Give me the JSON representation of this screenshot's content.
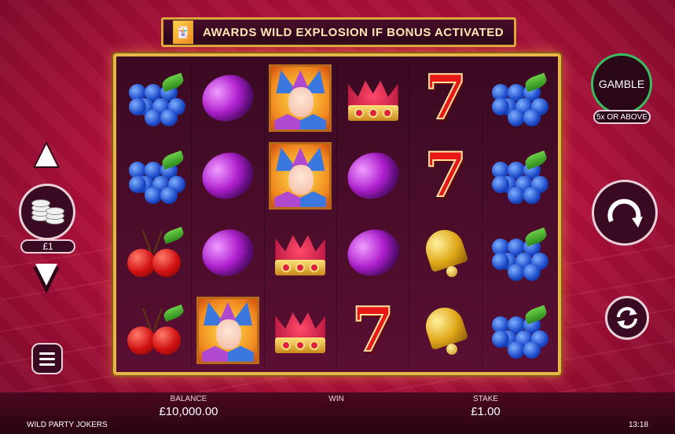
{
  "banner": {
    "text": "AWARDS WILD EXPLOSION IF BONUS ACTIVATED",
    "icon": "joker-icon"
  },
  "reels": [
    [
      "blueberry",
      "plum",
      "joker",
      "crown",
      "seven",
      "blueberry"
    ],
    [
      "blueberry",
      "plum",
      "joker",
      "plum",
      "seven",
      "blueberry"
    ],
    [
      "cherry",
      "plum",
      "crown",
      "plum",
      "bell",
      "blueberry"
    ],
    [
      "cherry",
      "joker",
      "crown",
      "seven",
      "bell",
      "blueberry"
    ]
  ],
  "controls": {
    "gamble_label": "GAMBLE",
    "gamble_sub": "5x OR ABOVE",
    "stake_pill": "£1"
  },
  "bottom": {
    "balance_label": "BALANCE",
    "balance_value": "£10,000.00",
    "win_label": "WIN",
    "win_value": "",
    "stake_label": "STAKE",
    "stake_value": "£1.00",
    "game_name": "WILD PARTY JOKERS",
    "clock": "13:18"
  },
  "colors": {
    "frame": "#e6b64a",
    "background": "#b4103c",
    "gamble_ring": "#38c060"
  }
}
